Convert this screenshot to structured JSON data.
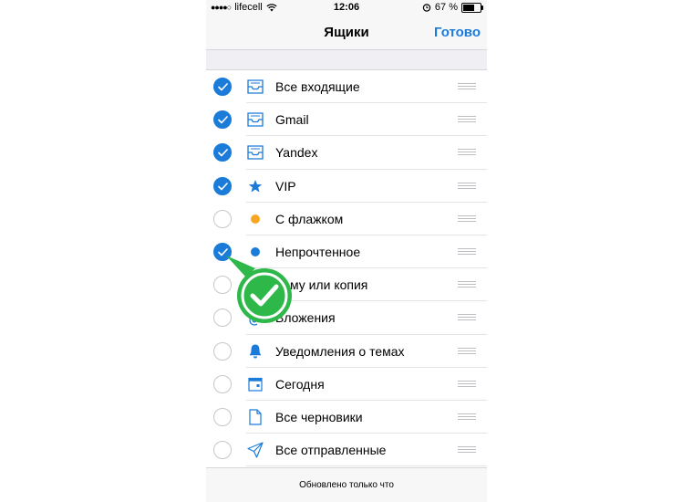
{
  "status_bar": {
    "carrier": "lifecell",
    "time": "12:06",
    "battery": "67 %",
    "battery_level": 0.67
  },
  "nav": {
    "title": "Ящики",
    "done": "Готово"
  },
  "mailboxes": [
    {
      "label": "Все входящие",
      "checked": true,
      "icon": "inbox-tray-icon"
    },
    {
      "label": "Gmail",
      "checked": true,
      "icon": "inbox-tray-icon"
    },
    {
      "label": "Yandex",
      "checked": true,
      "icon": "inbox-tray-icon"
    },
    {
      "label": "VIP",
      "checked": true,
      "icon": "star-icon"
    },
    {
      "label": "С флажком",
      "checked": false,
      "icon": "orange-dot-icon"
    },
    {
      "label": "Непрочтенное",
      "checked": true,
      "icon": "blue-dot-icon"
    },
    {
      "label": "Кому или копия",
      "checked": false,
      "icon": "person-icon"
    },
    {
      "label": "Вложения",
      "checked": false,
      "icon": "paperclip-icon"
    },
    {
      "label": "Уведомления о темах",
      "checked": false,
      "icon": "bell-icon"
    },
    {
      "label": "Сегодня",
      "checked": false,
      "icon": "calendar-icon"
    },
    {
      "label": "Все черновики",
      "checked": false,
      "icon": "document-icon"
    },
    {
      "label": "Все отправленные",
      "checked": false,
      "icon": "paper-plane-icon"
    }
  ],
  "footer": {
    "status": "Обновлено только что"
  },
  "colors": {
    "accent": "#1a7bd9",
    "flag": "#f5a623",
    "badge": "#2fb84a"
  }
}
